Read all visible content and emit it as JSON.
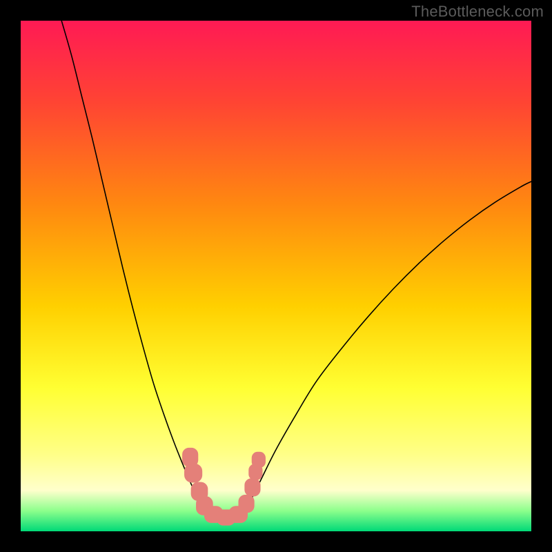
{
  "watermark": "TheBottleneck.com",
  "chart_data": {
    "type": "line",
    "title": "",
    "xlabel": "",
    "ylabel": "",
    "xlim": [
      0,
      100
    ],
    "ylim": [
      0,
      100
    ],
    "grid": false,
    "legend": "none",
    "background_gradient": {
      "stops": [
        {
          "offset": 0.0,
          "color": "#ff1a54"
        },
        {
          "offset": 0.16,
          "color": "#ff4433"
        },
        {
          "offset": 0.36,
          "color": "#ff8810"
        },
        {
          "offset": 0.56,
          "color": "#ffd000"
        },
        {
          "offset": 0.72,
          "color": "#ffff33"
        },
        {
          "offset": 0.85,
          "color": "#ffff88"
        },
        {
          "offset": 0.92,
          "color": "#ffffcc"
        },
        {
          "offset": 0.96,
          "color": "#8cff8c"
        },
        {
          "offset": 1.0,
          "color": "#00d977"
        }
      ]
    },
    "series": [
      {
        "name": "left-arm",
        "stroke": "#000000",
        "width": 1.6,
        "x": [
          8,
          10,
          12,
          14,
          16,
          18,
          20,
          22,
          24,
          26,
          28,
          30,
          32,
          33.5,
          35,
          36.5
        ],
        "y": [
          100,
          93,
          85,
          77,
          68.5,
          60,
          51.5,
          43.5,
          36,
          29,
          23,
          17.5,
          12.5,
          9,
          6,
          3.8
        ]
      },
      {
        "name": "right-arm",
        "stroke": "#000000",
        "width": 1.6,
        "x": [
          43.5,
          45,
          47,
          50,
          54,
          58,
          63,
          68,
          73,
          78,
          83,
          88,
          93,
          98,
          100
        ],
        "y": [
          3.8,
          6,
          10,
          16,
          23,
          29.5,
          36,
          42,
          47.5,
          52.5,
          57,
          61,
          64.5,
          67.5,
          68.5
        ]
      },
      {
        "name": "valley-floor",
        "stroke": "#000000",
        "width": 1.6,
        "x": [
          36.5,
          38,
          39.5,
          41,
          42.5,
          43.5
        ],
        "y": [
          3.8,
          2.6,
          2.2,
          2.2,
          2.6,
          3.8
        ]
      }
    ],
    "markers": [
      {
        "name": "coral-beads",
        "shape": "rounded-rect",
        "fill": "#e48079",
        "stroke": "#e48079",
        "points": [
          {
            "x": 33.2,
            "y": 14.5,
            "w": 3.0,
            "h": 3.6
          },
          {
            "x": 33.8,
            "y": 11.4,
            "w": 3.4,
            "h": 3.6
          },
          {
            "x": 35.0,
            "y": 7.8,
            "w": 3.2,
            "h": 3.6
          },
          {
            "x": 36.0,
            "y": 5.0,
            "w": 3.2,
            "h": 3.6
          },
          {
            "x": 37.8,
            "y": 3.3,
            "w": 3.6,
            "h": 3.2
          },
          {
            "x": 40.2,
            "y": 2.7,
            "w": 3.6,
            "h": 3.0
          },
          {
            "x": 42.6,
            "y": 3.3,
            "w": 3.6,
            "h": 3.2
          },
          {
            "x": 44.2,
            "y": 5.4,
            "w": 3.0,
            "h": 3.4
          },
          {
            "x": 45.4,
            "y": 8.6,
            "w": 3.0,
            "h": 3.4
          },
          {
            "x": 46.0,
            "y": 11.6,
            "w": 2.6,
            "h": 3.0
          },
          {
            "x": 46.6,
            "y": 14.0,
            "w": 2.6,
            "h": 3.0
          }
        ]
      }
    ]
  }
}
